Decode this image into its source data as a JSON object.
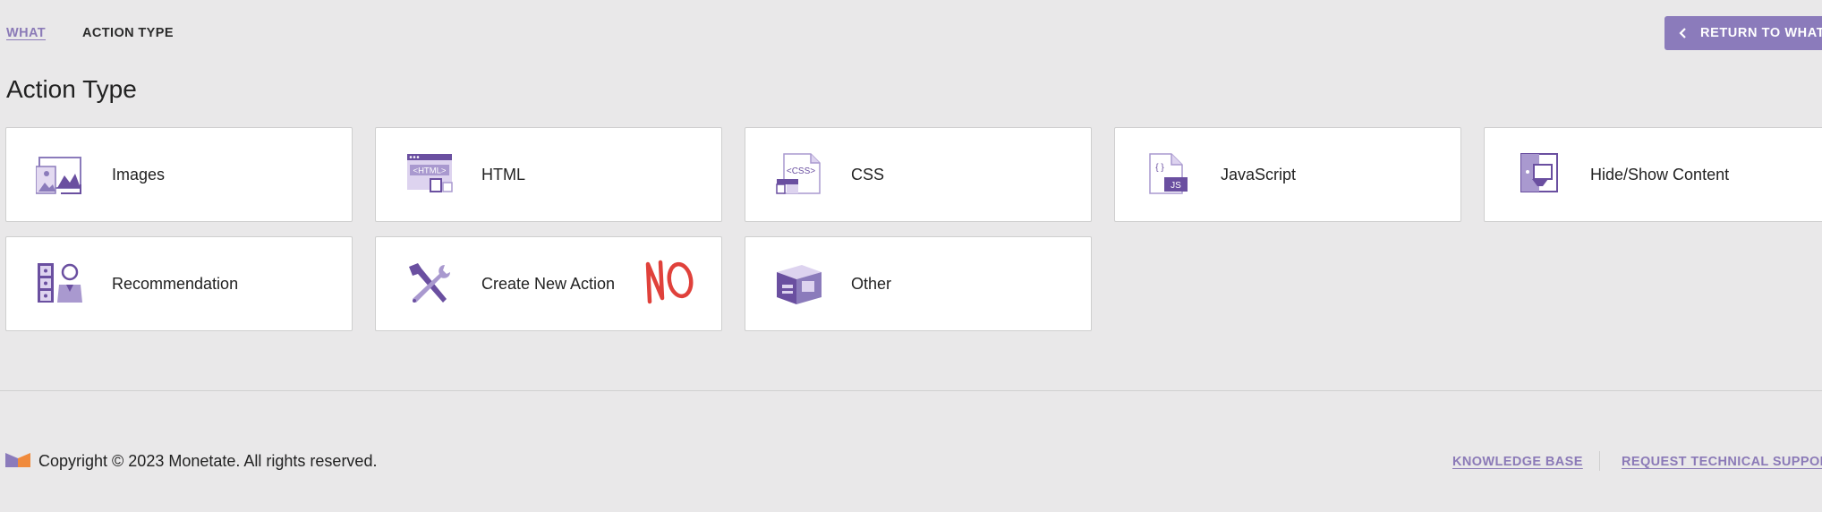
{
  "breadcrumb": {
    "parent_label": "WHAT",
    "current_label": "ACTION TYPE"
  },
  "return_button": {
    "label": "RETURN TO WHAT",
    "icon": "chevron-left-icon"
  },
  "page_title": "Action Type",
  "action_types": [
    {
      "label": "Images",
      "icon": "images-icon"
    },
    {
      "label": "HTML",
      "icon": "html-icon"
    },
    {
      "label": "CSS",
      "icon": "css-icon"
    },
    {
      "label": "JavaScript",
      "icon": "javascript-icon"
    },
    {
      "label": "Hide/Show Content",
      "icon": "hide-show-content-icon"
    },
    {
      "label": "Recommendation",
      "icon": "recommendation-icon"
    },
    {
      "label": "Create New Action",
      "icon": "tools-icon",
      "stamp": "NO"
    },
    {
      "label": "Other",
      "icon": "box-icon"
    }
  ],
  "footer": {
    "copyright": "Copyright © 2023 Monetate. All rights reserved.",
    "links": [
      "KNOWLEDGE BASE",
      "REQUEST TECHNICAL SUPPORT"
    ]
  },
  "colors": {
    "accent": "#8b7bbb",
    "link": "#8b7ab7",
    "icon_dark": "#6a4fa0",
    "icon_light": "#ddd3ef",
    "stamp_red": "#e0413b",
    "logo_orange": "#f08a3c"
  }
}
